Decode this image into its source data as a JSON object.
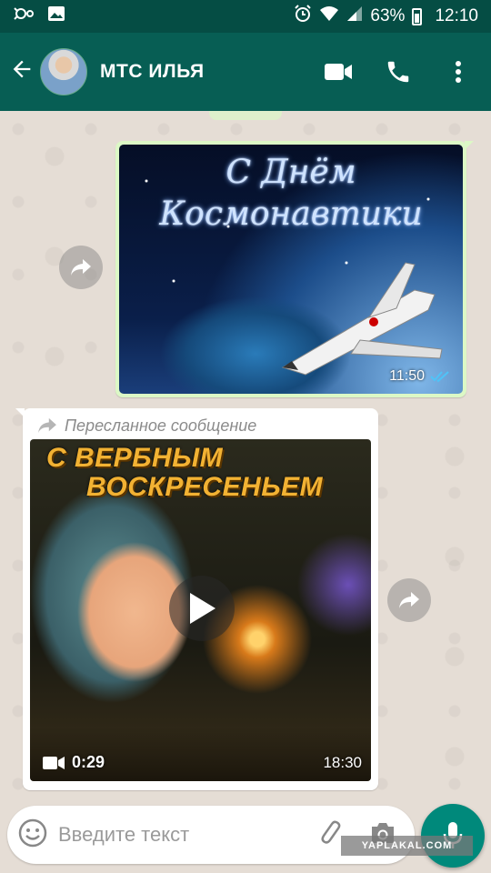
{
  "status_bar": {
    "battery": "63%",
    "time": "12:10",
    "icons": [
      "vr-icon",
      "image-icon",
      "alarm-icon",
      "wifi-icon",
      "signal-icon",
      "battery-icon"
    ]
  },
  "header": {
    "contact_name": "МТС ИЛЬЯ",
    "icons": [
      "back-arrow-icon",
      "video-call-icon",
      "phone-icon",
      "more-vert-icon"
    ]
  },
  "messages": [
    {
      "direction": "outgoing",
      "type": "image",
      "image_text_line1": "С Днём",
      "image_text_line2": "Космонавтики",
      "time": "11:50",
      "status_icon": "double-check-icon"
    },
    {
      "direction": "incoming",
      "type": "video",
      "forwarded_label": "Пересланное сообщение",
      "image_text_line1": "С ВЕРБНЫМ",
      "image_text_line2": "ВОСКРЕСЕНЬЕМ",
      "duration": "0:29",
      "time": "18:30"
    }
  ],
  "composer": {
    "placeholder": "Введите текст",
    "icons": [
      "emoji-icon",
      "attach-icon",
      "camera-icon",
      "mic-icon"
    ]
  },
  "watermark": "YAPLAKAL.COM",
  "colors": {
    "header": "#075e54",
    "status_bar": "#054d44",
    "outgoing_bubble": "#dcf8c6",
    "incoming_bubble": "#ffffff",
    "accent": "#00897b",
    "check_blue": "#4fc3f7"
  }
}
